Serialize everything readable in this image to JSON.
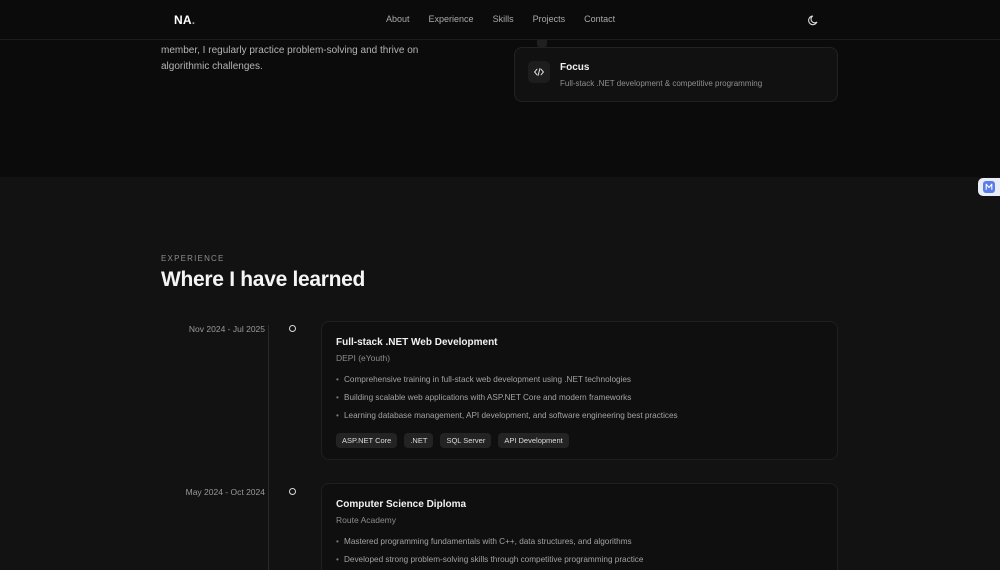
{
  "nav": {
    "brand": "NA",
    "brand_dot": ".",
    "links": [
      "About",
      "Experience",
      "Skills",
      "Projects",
      "Contact"
    ],
    "theme_icon": "moon-icon"
  },
  "about": {
    "text": "member, I regularly practice problem-solving and thrive on algorithmic challenges.",
    "focus": {
      "icon": "code-icon",
      "title": "Focus",
      "description": "Full-stack .NET development & competitive programming"
    }
  },
  "experience": {
    "eyebrow": "EXPERIENCE",
    "title": "Where I have learned",
    "items": [
      {
        "date": "Nov 2024 - Jul 2025",
        "title": "Full-stack .NET Web Development",
        "org": "DEPI (eYouth)",
        "bullets": [
          "Comprehensive training in full-stack web development using .NET technologies",
          "Building scalable web applications with ASP.NET Core and modern frameworks",
          "Learning database management, API development, and software engineering best practices"
        ],
        "tags": [
          "ASP.NET Core",
          ".NET",
          "SQL Server",
          "API Development"
        ]
      },
      {
        "date": "May 2024 - Oct 2024",
        "title": "Computer Science Diploma",
        "org": "Route Academy",
        "bullets": [
          "Mastered programming fundamentals with C++, data structures, and algorithms",
          "Developed strong problem-solving skills through competitive programming practice"
        ],
        "tags": []
      }
    ]
  },
  "colors": {
    "background": "#0b0b0b",
    "section_background": "#121212",
    "card_background": "#0f0f0f",
    "accent_widget": "#5a7de8"
  }
}
